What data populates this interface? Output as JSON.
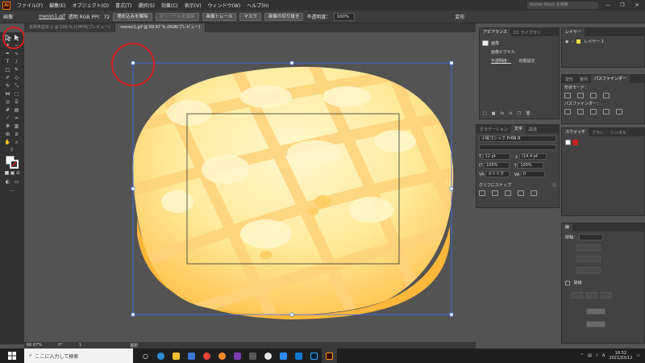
{
  "menubar": {
    "app_logo": "Ai",
    "items": [
      "ファイル(F)",
      "編集(E)",
      "オブジェクト(O)",
      "書式(T)",
      "選択(S)",
      "効果(C)",
      "表示(V)",
      "ウィンドウ(W)",
      "ヘルプ(H)"
    ],
    "search_placeholder": "Adobe Stock を検索",
    "window_controls": [
      "—",
      "❐",
      "✕"
    ]
  },
  "controlbar": {
    "label": "画像",
    "filename": "meron1.gif",
    "info": "透明 RGB PPI：72",
    "btn_embed": "埋め込みを解除",
    "btn_original": "オリジナルを編集",
    "btn_trace": "画像トレース",
    "btn_mask": "マスク",
    "btn_crop": "画像の切り抜き",
    "opacity_label": "不透明度：",
    "opacity_value": "100%",
    "transform_label": "変形"
  },
  "tabs": [
    {
      "label": "名称未設定-1 @ 100 % (CMYK/プレビュー)",
      "active": false
    },
    {
      "label": "meron1.gif @ 69.67 % (RGB/プレビュー)",
      "active": true
    }
  ],
  "status": {
    "zoom": "66.67%",
    "angle": "0°",
    "page": "1",
    "mode": "選択"
  },
  "appearance_panel": {
    "tabs": [
      "アピアランス",
      "CC ライブラリ"
    ],
    "rows": [
      "画像",
      "画像ピクセル",
      "不透明度：",
      "初期設定"
    ]
  },
  "layers_panel": {
    "tab": "レイヤー",
    "layer_name": "レイヤー 1"
  },
  "character_panel": {
    "tabs": [
      "グラデーション",
      "文字",
      "段落"
    ],
    "font": "小塚ゴシック Pr6N R",
    "size": "12 pt",
    "leading": "(14.4 pt",
    "hscale": "100%",
    "vscale": "100%",
    "kerning": "メトリク",
    "tracking": "0",
    "snap_label": "グリフにスナップ"
  },
  "pathfinder_panel": {
    "tabs": [
      "変形",
      "整列",
      "パスファインダー"
    ],
    "shape_mode": "形状モード：",
    "pathfinder": "パスファインダー："
  },
  "swatch_panel": {
    "tabs": [
      "スウォッチ",
      "ブラシ",
      "シンボル"
    ]
  },
  "stroke_panel": {
    "tab": "線",
    "weight_label": "線幅：",
    "dashed": "破線"
  },
  "taskbar": {
    "search_placeholder": "ここに入力して検索",
    "time": "18:52",
    "date": "2021/03/12",
    "apps": [
      "task-view",
      "edge",
      "explorer",
      "store",
      "chrome",
      "firefox",
      "onenote",
      "calculator",
      "music",
      "notes",
      "vscode",
      "photoshop",
      "illustrator"
    ]
  },
  "colors": {
    "bread_dark": "#ffc24d",
    "bread_light": "#fff2b0",
    "grid_stripe": "#ffd880",
    "selection": "#3a6fff",
    "annotation": "#d42020"
  }
}
